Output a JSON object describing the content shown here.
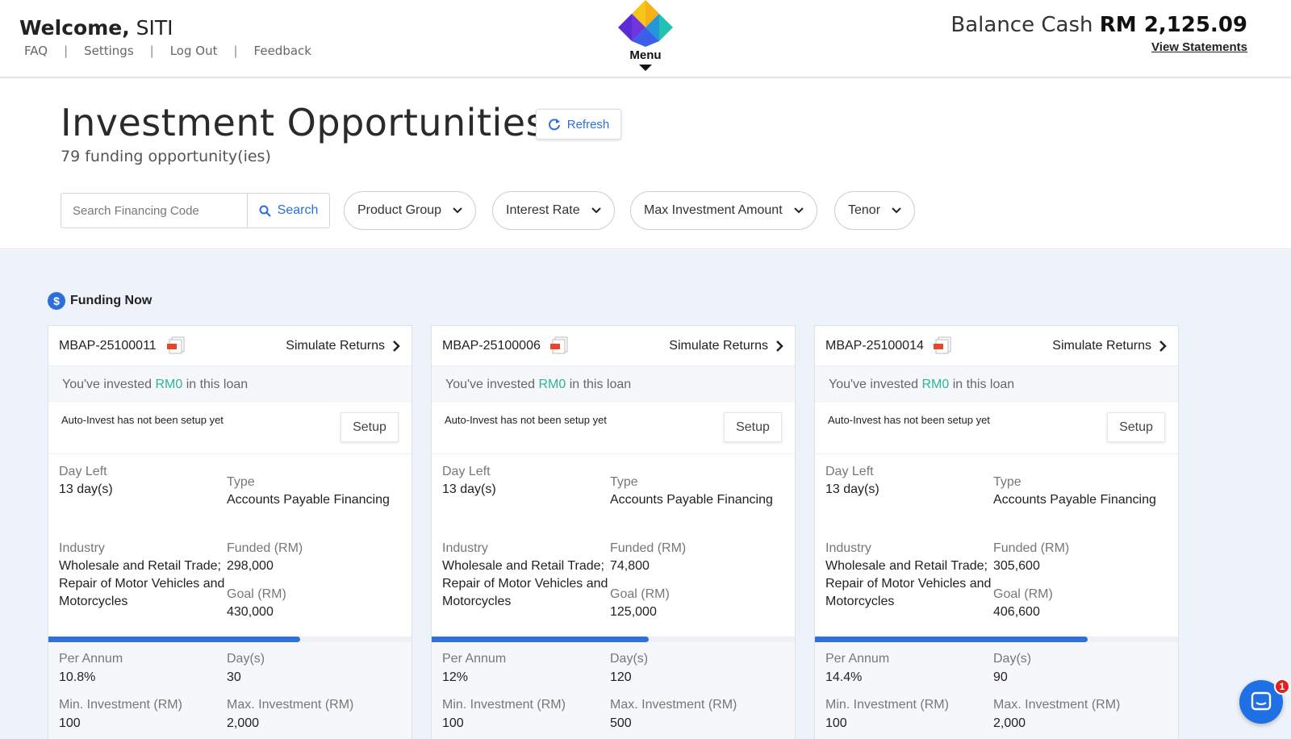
{
  "header": {
    "welcome_word": "Welcome,",
    "user_name": "SITI",
    "links": [
      "FAQ",
      "Settings",
      "Log Out",
      "Feedback"
    ],
    "link_separator": "|",
    "menu_label": "Menu",
    "balance_label": "Balance Cash",
    "balance_amount": "RM 2,125.09",
    "view_statements": "View Statements"
  },
  "page": {
    "title": "Investment Opportunities",
    "refresh_label": "Refresh",
    "subtitle": "79 funding opportunity(ies)"
  },
  "search": {
    "placeholder": "Search Financing Code",
    "button_label": "Search"
  },
  "filters": [
    "Product Group",
    "Interest Rate",
    "Max Investment Amount",
    "Tenor"
  ],
  "section": {
    "icon_symbol": "$",
    "title": "Funding Now"
  },
  "card_labels": {
    "simulate": "Simulate Returns",
    "invested_prefix": "You've invested",
    "invested_amount": "RM0",
    "invested_suffix": "in this loan",
    "auto_invest": "Auto-Invest has not been setup yet",
    "setup": "Setup",
    "day_left": "Day Left",
    "type": "Type",
    "industry": "Industry",
    "funded": "Funded (RM)",
    "goal": "Goal (RM)",
    "per_annum": "Per Annum",
    "days": "Day(s)",
    "min_investment": "Min. Investment (RM)",
    "max_investment": "Max. Investment (RM)"
  },
  "cards": [
    {
      "code": "MBAP-25100011",
      "day_left": "13 day(s)",
      "type": "Accounts Payable Financing",
      "industry": "Wholesale and Retail Trade; Repair of Motor Vehicles and Motorcycles",
      "funded": "298,000",
      "goal": "430,000",
      "funded_fraction": 0.693,
      "per_annum": "10.8%",
      "days": "30",
      "min_investment": "100",
      "max_investment": "2,000"
    },
    {
      "code": "MBAP-25100006",
      "day_left": "13 day(s)",
      "type": "Accounts Payable Financing",
      "industry": "Wholesale and Retail Trade; Repair of Motor Vehicles and Motorcycles",
      "funded": "74,800",
      "goal": "125,000",
      "funded_fraction": 0.598,
      "per_annum": "12%",
      "days": "120",
      "min_investment": "100",
      "max_investment": "500"
    },
    {
      "code": "MBAP-25100014",
      "day_left": "13 day(s)",
      "type": "Accounts Payable Financing",
      "industry": "Wholesale and Retail Trade; Repair of Motor Vehicles and Motorcycles",
      "funded": "305,600",
      "goal": "406,600",
      "funded_fraction": 0.752,
      "per_annum": "14.4%",
      "days": "90",
      "min_investment": "100",
      "max_investment": "2,000"
    }
  ],
  "chat": {
    "badge_count": "1"
  },
  "colors": {
    "accent": "#2a6fdb",
    "progress": "#2f6fe0",
    "invested_amount": "#2bb5a0",
    "content_bg": "#eef2fa",
    "badge": "#e0201e"
  }
}
